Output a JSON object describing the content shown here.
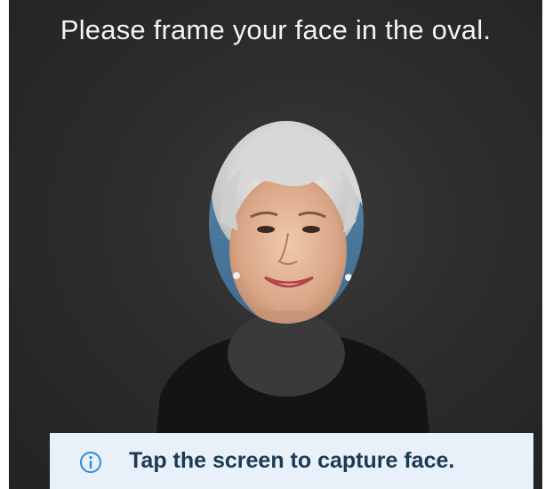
{
  "screen": {
    "instruction": "Please frame your face in the oval."
  },
  "banner": {
    "icon": "info-icon",
    "text": "Tap the screen to capture face.",
    "background": "#e8f1fa",
    "accent": "#2f88d8"
  }
}
